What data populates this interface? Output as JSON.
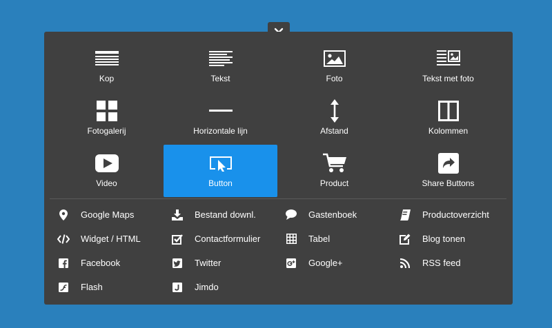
{
  "close": {
    "icon": "close-icon"
  },
  "tiles": [
    {
      "label": "Kop",
      "icon": "heading-icon"
    },
    {
      "label": "Tekst",
      "icon": "text-icon"
    },
    {
      "label": "Foto",
      "icon": "photo-icon"
    },
    {
      "label": "Tekst met foto",
      "icon": "text-with-photo-icon"
    },
    {
      "label": "Fotogalerij",
      "icon": "gallery-icon"
    },
    {
      "label": "Horizontale lijn",
      "icon": "horizontal-line-icon"
    },
    {
      "label": "Afstand",
      "icon": "spacing-icon"
    },
    {
      "label": "Kolommen",
      "icon": "columns-icon"
    },
    {
      "label": "Video",
      "icon": "video-icon"
    },
    {
      "label": "Button",
      "icon": "button-icon",
      "active": true
    },
    {
      "label": "Product",
      "icon": "cart-icon"
    },
    {
      "label": "Share Buttons",
      "icon": "share-icon"
    }
  ],
  "links": [
    {
      "label": "Google Maps",
      "icon": "map-pin-icon"
    },
    {
      "label": "Bestand downl.",
      "icon": "download-icon"
    },
    {
      "label": "Gastenboek",
      "icon": "speech-bubble-icon"
    },
    {
      "label": "Productoverzicht",
      "icon": "catalog-icon"
    },
    {
      "label": "Widget / HTML",
      "icon": "code-icon"
    },
    {
      "label": "Contactformulier",
      "icon": "checkbox-icon"
    },
    {
      "label": "Tabel",
      "icon": "table-icon"
    },
    {
      "label": "Blog tonen",
      "icon": "edit-icon"
    },
    {
      "label": "Facebook",
      "icon": "facebook-icon"
    },
    {
      "label": "Twitter",
      "icon": "twitter-icon"
    },
    {
      "label": "Google+",
      "icon": "google-plus-icon"
    },
    {
      "label": "RSS feed",
      "icon": "rss-icon"
    },
    {
      "label": "Flash",
      "icon": "flash-icon"
    },
    {
      "label": "Jimdo",
      "icon": "jimdo-icon"
    }
  ],
  "colors": {
    "background": "#2a80bc",
    "panel": "#404040",
    "active": "#1991eb",
    "divider": "#5a5a5a",
    "text": "#ffffff"
  }
}
